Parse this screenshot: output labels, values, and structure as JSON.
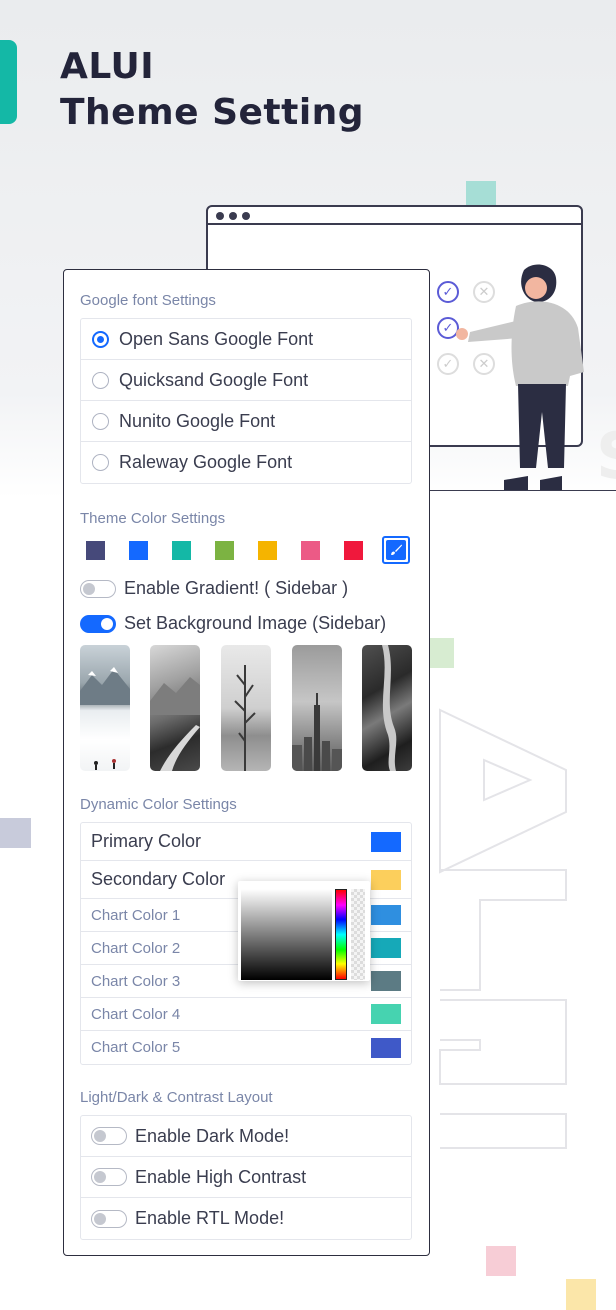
{
  "hero": {
    "line1": "ALUI",
    "line2": "Theme Setting"
  },
  "fonts": {
    "section_title": "Google font Settings",
    "options": [
      {
        "label": "Open Sans Google Font",
        "selected": true
      },
      {
        "label": "Quicksand Google Font",
        "selected": false
      },
      {
        "label": "Nunito Google Font",
        "selected": false
      },
      {
        "label": "Raleway Google Font",
        "selected": false
      }
    ]
  },
  "theme_color": {
    "section_title": "Theme Color Settings",
    "swatches": [
      "#46497a",
      "#1469ff",
      "#14b8a6",
      "#7cb342",
      "#f5b400",
      "#ec5a86",
      "#f0183c"
    ],
    "active_swatch": {
      "color": "#1469ff",
      "icon": "paintbrush-icon"
    },
    "gradient_toggle": {
      "label": "Enable Gradient! ( Sidebar )",
      "on": false
    },
    "background_toggle": {
      "label": "Set Background Image (Sidebar)",
      "on": true
    },
    "background_images": [
      "snowy-mountain",
      "mountain-road",
      "bare-tree-lake",
      "city-skyline",
      "rocky-river"
    ]
  },
  "dynamic_colors": {
    "section_title": "Dynamic Color Settings",
    "rows": [
      {
        "label": "Primary Color",
        "color": "#1469ff"
      },
      {
        "label": "Secondary Color",
        "color": "#fccf5c"
      },
      {
        "label": "Chart Color 1",
        "color": "#2f8fe0"
      },
      {
        "label": "Chart Color 2",
        "color": "#16a9b8"
      },
      {
        "label": "Chart Color 3",
        "color": "#5c7b84"
      },
      {
        "label": "Chart Color 4",
        "color": "#46d3b0"
      },
      {
        "label": "Chart Color 5",
        "color": "#3f59c8"
      }
    ]
  },
  "layout": {
    "section_title": "Light/Dark & Contrast Layout",
    "options": [
      {
        "label": "Enable Dark Mode!",
        "on": false
      },
      {
        "label": "Enable High Contrast",
        "on": false
      },
      {
        "label": "Enable RTL Mode!",
        "on": false
      }
    ]
  }
}
